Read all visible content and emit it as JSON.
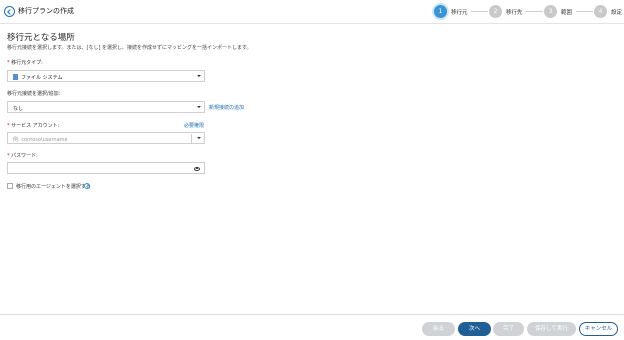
{
  "header": {
    "title": "移行プランの作成",
    "steps": [
      {
        "number": "1",
        "label": "移行元"
      },
      {
        "number": "2",
        "label": "移行先"
      },
      {
        "number": "3",
        "label": "範囲"
      },
      {
        "number": "4",
        "label": "設定"
      }
    ]
  },
  "form": {
    "heading": "移行元となる場所",
    "description": "移行元接続を選択します。または、[なし] を選択し、接続を作成せずにマッピングを一括インポートします。",
    "source_type": {
      "label": "移行元タイプ:",
      "value": "ファイル システム"
    },
    "connection": {
      "label": "移行元接続を選択/追加:",
      "value": "なし",
      "add_link": "新規接続の追加"
    },
    "service_account": {
      "label": "サービス アカウント:",
      "placeholder": "例: contoso\\username",
      "link": "必要権限"
    },
    "password": {
      "label": "パスワード:",
      "value": ""
    },
    "agent_checkbox_label": "移行用のエージェントを選択する"
  },
  "footer": {
    "back": "戻る",
    "next": "次へ",
    "finish": "完了",
    "save_run": "保存して実行",
    "cancel": "キャンセル"
  },
  "colors": {
    "accent": "#3a95d3",
    "primary": "#1f5f95",
    "link": "#1e6fb8",
    "required": "#d0021b"
  }
}
